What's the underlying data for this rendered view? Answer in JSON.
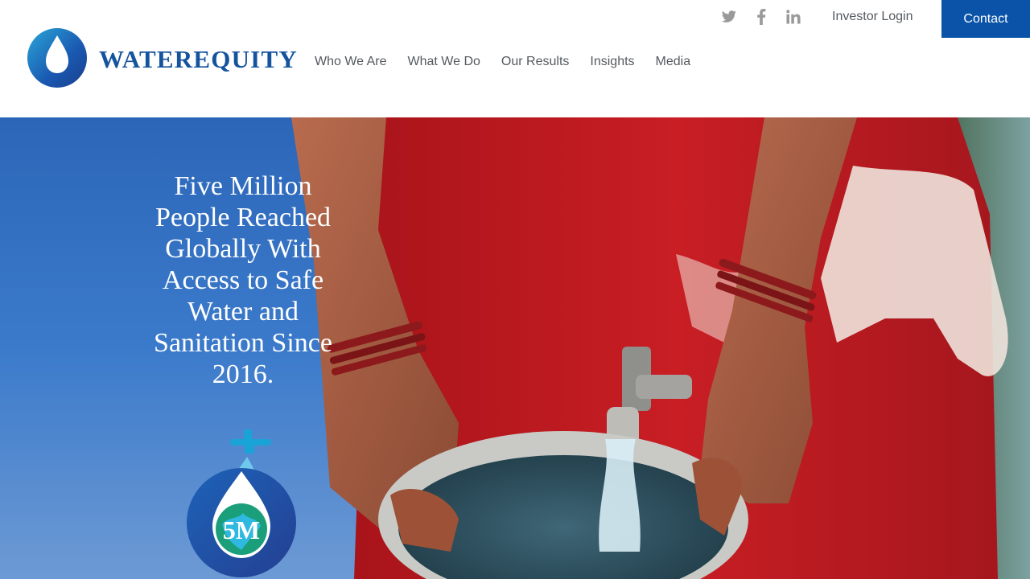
{
  "brand": {
    "name_part1": "WATER",
    "name_part2": "EQUITY",
    "primary_color": "#14549e",
    "accent_color": "#0a53a8"
  },
  "nav": {
    "items": [
      {
        "label": "Who We Are"
      },
      {
        "label": "What We Do"
      },
      {
        "label": "Our Results"
      },
      {
        "label": "Insights"
      },
      {
        "label": "Media"
      }
    ]
  },
  "topbar": {
    "social": [
      {
        "icon": "twitter-icon"
      },
      {
        "icon": "facebook-icon"
      },
      {
        "icon": "linkedin-icon"
      }
    ],
    "investor_login": "Investor Login",
    "contact": "Contact"
  },
  "hero": {
    "headline": "Five Million People Reached Globally With Access to Safe Water and Sanitation Since 2016.",
    "badge_text": "5M"
  }
}
